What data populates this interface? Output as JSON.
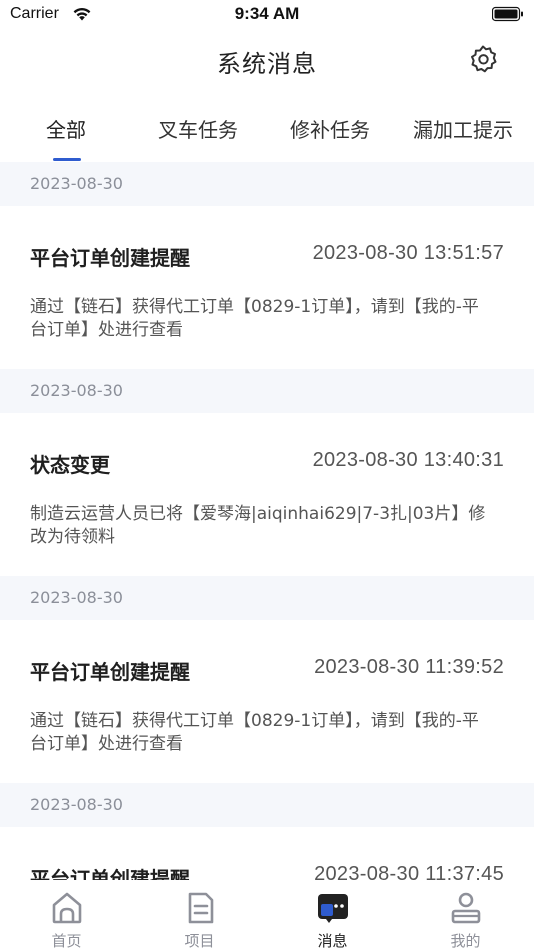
{
  "status_bar": {
    "carrier": "Carrier",
    "time": "9:34 AM"
  },
  "header": {
    "title": "系统消息"
  },
  "tabs": [
    {
      "label": "全部",
      "active": true
    },
    {
      "label": "叉车任务",
      "active": false
    },
    {
      "label": "修补任务",
      "active": false
    },
    {
      "label": "漏加工提示",
      "active": false
    }
  ],
  "messages": [
    {
      "date": "2023-08-30",
      "title": "平台订单创建提醒",
      "time": "2023-08-30 13:51:57",
      "body": "通过【链石】获得代工订单【0829-1订单】，请到【我的-平台订单】处进行查看"
    },
    {
      "date": "2023-08-30",
      "title": "状态变更",
      "time": "2023-08-30 13:40:31",
      "body": "制造云运营人员已将【爱琴海|aiqinhai629|7-3扎|03片】修改为待领料"
    },
    {
      "date": "2023-08-30",
      "title": "平台订单创建提醒",
      "time": "2023-08-30 11:39:52",
      "body": "通过【链石】获得代工订单【0829-1订单】，请到【我的-平台订单】处进行查看"
    },
    {
      "date": "2023-08-30",
      "title": "平台订单创建提醒",
      "time": "2023-08-30 11:37:45",
      "body": ""
    }
  ],
  "tabbar": [
    {
      "label": "首页",
      "icon": "home-icon",
      "active": false
    },
    {
      "label": "项目",
      "icon": "document-icon",
      "active": false
    },
    {
      "label": "消息",
      "icon": "message-icon",
      "active": true
    },
    {
      "label": "我的",
      "icon": "profile-icon",
      "active": false
    }
  ],
  "colors": {
    "accent": "#2f5ccf",
    "separator_bg": "#f5f7fb",
    "muted_text": "#8b8f99"
  }
}
